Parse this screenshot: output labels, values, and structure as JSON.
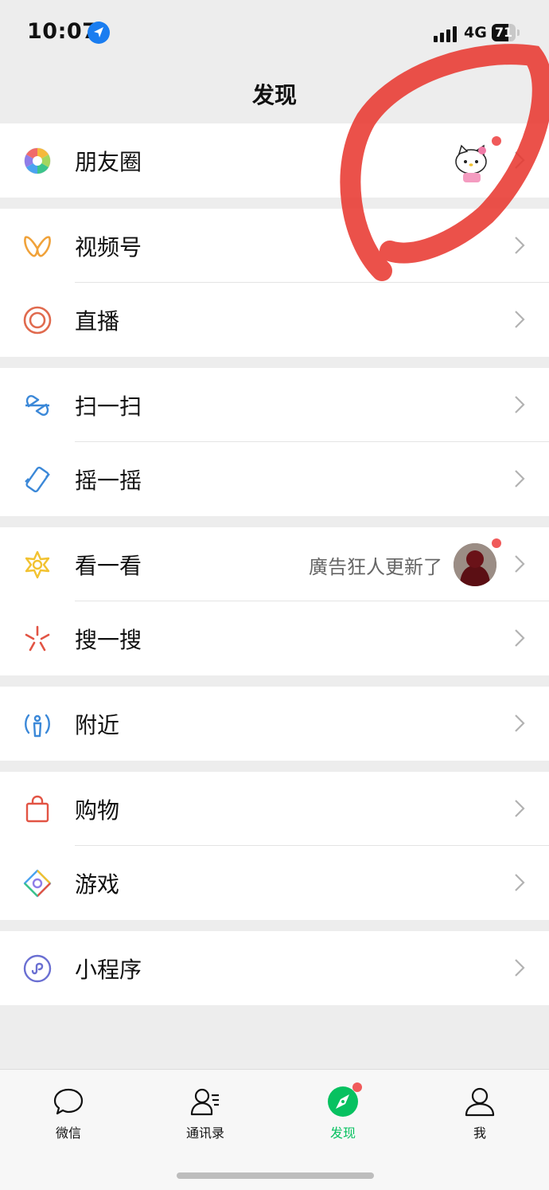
{
  "status_bar": {
    "time": "10:07",
    "network": "4G",
    "battery": "71",
    "battery_level": 0.71
  },
  "page": {
    "title": "发现"
  },
  "sections": [
    {
      "items": [
        {
          "label": "朋友圈",
          "icon": "moments-aperture-icon",
          "badge": "red-dot"
        }
      ]
    },
    {
      "items": [
        {
          "label": "视频号",
          "icon": "channels-icon"
        },
        {
          "label": "直播",
          "icon": "live-icon"
        }
      ]
    },
    {
      "items": [
        {
          "label": "扫一扫",
          "icon": "scan-icon"
        },
        {
          "label": "摇一摇",
          "icon": "shake-icon"
        }
      ]
    },
    {
      "items": [
        {
          "label": "看一看",
          "icon": "top-stories-icon",
          "subtext": "廣告狂人更新了",
          "badge": "red-dot"
        },
        {
          "label": "搜一搜",
          "icon": "search-icon"
        }
      ]
    },
    {
      "items": [
        {
          "label": "附近",
          "icon": "nearby-icon"
        }
      ]
    },
    {
      "items": [
        {
          "label": "购物",
          "icon": "shopping-bag-icon"
        },
        {
          "label": "游戏",
          "icon": "games-icon"
        }
      ]
    },
    {
      "items": [
        {
          "label": "小程序",
          "icon": "mini-program-icon"
        }
      ]
    }
  ],
  "tabbar": {
    "tabs": [
      {
        "label": "微信",
        "icon": "chat-bubble-icon"
      },
      {
        "label": "通讯录",
        "icon": "contacts-icon"
      },
      {
        "label": "发现",
        "icon": "discover-compass-icon",
        "active": true,
        "badge": "red-dot"
      },
      {
        "label": "我",
        "icon": "me-person-icon"
      }
    ]
  },
  "colors": {
    "accent_green": "#07c160",
    "badge_red": "#f05a5a",
    "annotation_red": "#e8322a"
  }
}
